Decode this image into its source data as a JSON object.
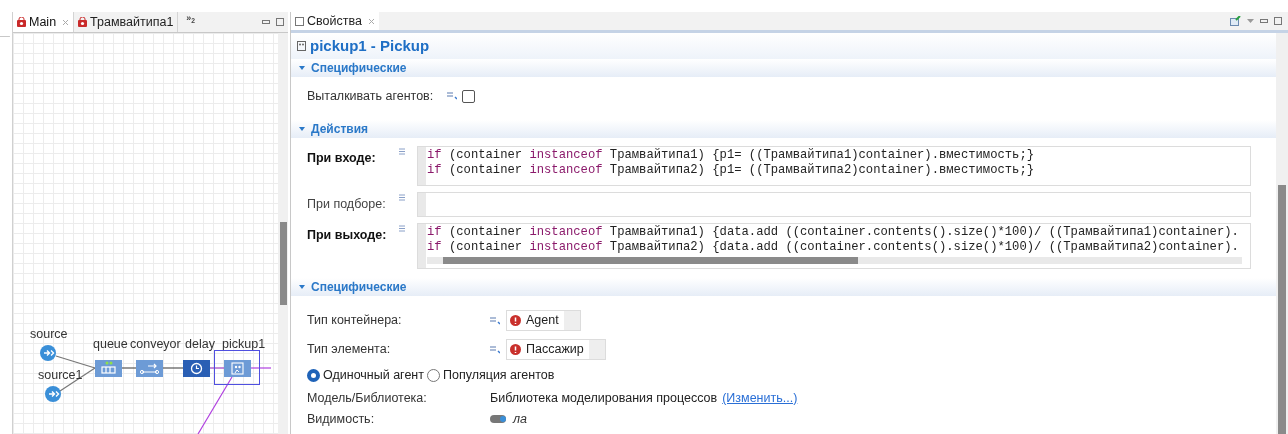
{
  "editor": {
    "tabs": [
      {
        "label": "Main",
        "selected": true
      },
      {
        "label": "Трамвайтипа1",
        "selected": false
      }
    ],
    "overflow": "»$_{2}$",
    "nodes": [
      {
        "label": "source",
        "kind": "source",
        "selected": false
      },
      {
        "label": "source1",
        "kind": "source",
        "selected": false
      },
      {
        "label": "queue",
        "kind": "queue",
        "selected": false
      },
      {
        "label": "conveyor",
        "kind": "conveyor",
        "selected": false
      },
      {
        "label": "delay",
        "kind": "delay",
        "selected": false
      },
      {
        "label": "pickup1",
        "kind": "pickup",
        "selected": true
      }
    ]
  },
  "properties": {
    "tab": "Свойства",
    "title": "pickup1 - Pickup",
    "sections": [
      {
        "title": "Специфические",
        "expanded": true,
        "rows": [
          {
            "kind": "checkbox",
            "label": "Выталкивать агентов:",
            "checked": false
          }
        ]
      },
      {
        "title": "Действия",
        "expanded": true,
        "rows": [
          {
            "kind": "code",
            "label": "При входе:",
            "modified": true,
            "h_scrollbar": false,
            "lines": [
              [
                {
                  "text": "if",
                  "kind": "keyword"
                },
                {
                  "text": " (container ",
                  "kind": "plain"
                },
                {
                  "text": "instanceof",
                  "kind": "keyword"
                },
                {
                  "text": " Трамвайтипа1) {p1= ((Трамвайтипа1)container).вместимость;}",
                  "kind": "plain"
                }
              ],
              [
                {
                  "text": "if",
                  "kind": "keyword"
                },
                {
                  "text": " (container ",
                  "kind": "plain"
                },
                {
                  "text": "instanceof",
                  "kind": "keyword"
                },
                {
                  "text": " Трамвайтипа2) {p1= ((Трамвайтипа2)container).вместимость;}",
                  "kind": "plain"
                }
              ]
            ]
          },
          {
            "kind": "code",
            "label": "При подборе:",
            "modified": false,
            "h_scrollbar": false
          },
          {
            "kind": "code",
            "label": "При выходе:",
            "modified": true,
            "h_scrollbar": true,
            "lines": [
              [
                {
                  "text": "if",
                  "kind": "keyword"
                },
                {
                  "text": " (container ",
                  "kind": "plain"
                },
                {
                  "text": "instanceof",
                  "kind": "keyword"
                },
                {
                  "text": " Трамвайтипа1) {data.add ((container.contents().size()*100)/ ((Трамвайтипа1)container).",
                  "kind": "plain"
                }
              ],
              [
                {
                  "text": "if",
                  "kind": "keyword"
                },
                {
                  "text": " (container ",
                  "kind": "plain"
                },
                {
                  "text": "instanceof",
                  "kind": "keyword"
                },
                {
                  "text": " Трамвайтипа2) {data.add ((container.contents().size()*100)/ ((Трамвайтипа2)container).",
                  "kind": "plain"
                }
              ]
            ]
          }
        ]
      },
      {
        "title": "Специфические",
        "expanded": true,
        "rows": [
          {
            "kind": "type",
            "label": "Тип контейнера:",
            "value": "Agent"
          },
          {
            "kind": "type",
            "label": "Тип элемента:",
            "value": "Пассажир"
          },
          {
            "kind": "radio",
            "options": [
              {
                "label": "Одиночный агент",
                "selected": true
              },
              {
                "label": "Популяция агентов",
                "selected": false
              }
            ]
          },
          {
            "kind": "info",
            "label": "Модель/Библиотека:",
            "value": "Библиотека моделирования процессов",
            "link": "(Изменить...)"
          },
          {
            "kind": "toggle",
            "label": "Видимость:",
            "on": true,
            "value": "ла"
          }
        ]
      }
    ]
  }
}
